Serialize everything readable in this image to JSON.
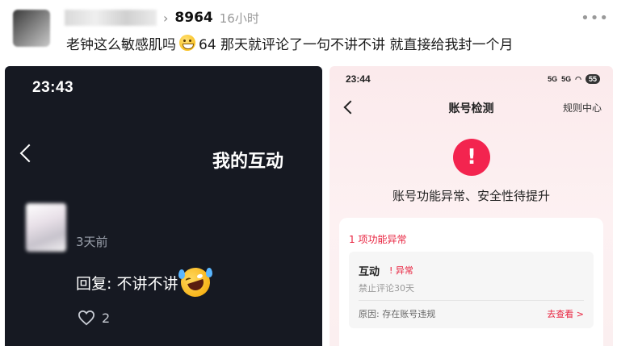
{
  "post": {
    "views": "8964",
    "time": "16小时",
    "more": "•••",
    "text_before": "老钟这么敏感肌吗",
    "text_after": "64 那天就评论了一句不讲不讲 就直接给我封一个月"
  },
  "left_screen": {
    "clock": "23:43",
    "title": "我的互动",
    "ago": "3天前",
    "reply": "回复: 不讲不讲",
    "likes": "2"
  },
  "right_screen": {
    "clock": "23:44",
    "battery": "55",
    "signal_1": "5G",
    "signal_2": "5G",
    "nav_title": "账号检测",
    "nav_rules": "规则中心",
    "warning_symbol": "!",
    "warning_text": "账号功能异常、安全性待提升",
    "section_title": "1 项功能异常",
    "item_name": "互动",
    "item_status": "! 异常",
    "item_desc": "禁止评论30天",
    "item_reason": "原因: 存在账号违规",
    "item_link": "去查看 >"
  },
  "colors": {
    "accent_red": "#f3244f",
    "dark_bg": "#161922",
    "pink_bg": "#fbeaec"
  },
  "icons": [
    "chevron-right-icon",
    "more-icon",
    "grin-sweat-emoji",
    "back-icon",
    "laugh-emoji",
    "heart-icon",
    "signal-icon",
    "wifi-icon",
    "battery-icon",
    "warning-icon"
  ]
}
